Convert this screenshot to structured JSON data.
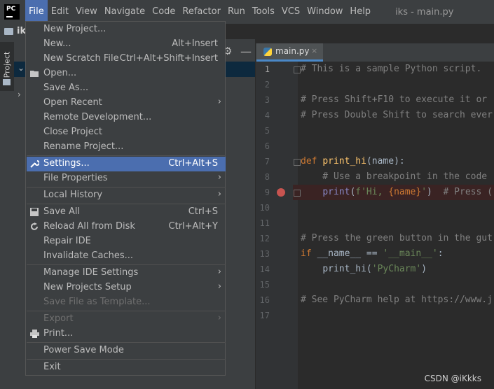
{
  "menubar": {
    "logo": "PC",
    "items": [
      "File",
      "Edit",
      "View",
      "Navigate",
      "Code",
      "Refactor",
      "Run",
      "Tools",
      "VCS",
      "Window",
      "Help"
    ],
    "window_title": "iks - main.py"
  },
  "project": {
    "strip_label": "ik",
    "tab_label": "Project"
  },
  "editor": {
    "tab_name": "main.py",
    "tab_close": "×",
    "lines": [
      {
        "num": "1"
      },
      {
        "num": "2"
      },
      {
        "num": "3"
      },
      {
        "num": "4"
      },
      {
        "num": "5"
      },
      {
        "num": "6"
      },
      {
        "num": "7"
      },
      {
        "num": "8"
      },
      {
        "num": "9"
      },
      {
        "num": "10"
      },
      {
        "num": "11"
      },
      {
        "num": "12"
      },
      {
        "num": "13"
      },
      {
        "num": "14"
      },
      {
        "num": "15"
      },
      {
        "num": "16"
      },
      {
        "num": "17"
      }
    ],
    "code": {
      "l1": "# This is a sample Python script.",
      "l3": "# Press Shift+F10 to execute it or",
      "l4": "# Press Double Shift to search ever",
      "l7_kw": "def ",
      "l7_fn": "print_hi",
      "l7_rest": "(name):",
      "l8": "    # Use a breakpoint in the code",
      "l9_indent": "    ",
      "l9_bi": "print",
      "l9_p1": "(",
      "l9_st1": "f'Hi, ",
      "l9_var": "{name}",
      "l9_st2": "'",
      "l9_p2": ")  ",
      "l9_cm": "# Press (",
      "l12": "# Press the green button in the gut",
      "l13_kw": "if ",
      "l13_mid": "__name__ == ",
      "l13_st": "'__main__'",
      "l13_end": ":",
      "l14_indent": "    ",
      "l14_fn": "print_hi(",
      "l14_st": "'PyCharm'",
      "l14_end": ")",
      "l16": "# See PyCharm help at https://www.j"
    }
  },
  "file_menu": {
    "new_project": "New Project...",
    "new": "New...",
    "new_short": "Alt+Insert",
    "new_scratch": "New Scratch File",
    "new_scratch_short": "Ctrl+Alt+Shift+Insert",
    "open": "Open...",
    "save_as": "Save As...",
    "open_recent": "Open Recent",
    "remote_dev": "Remote Development...",
    "close_project": "Close Project",
    "rename_project": "Rename Project...",
    "settings": "Settings...",
    "settings_short": "Ctrl+Alt+S",
    "file_properties": "File Properties",
    "local_history": "Local History",
    "save_all": "Save All",
    "save_all_short": "Ctrl+S",
    "reload": "Reload All from Disk",
    "reload_short": "Ctrl+Alt+Y",
    "repair_ide": "Repair IDE",
    "invalidate": "Invalidate Caches...",
    "manage_ide": "Manage IDE Settings",
    "new_projects_setup": "New Projects Setup",
    "save_template": "Save File as Template...",
    "export": "Export",
    "print": "Print...",
    "power_save": "Power Save Mode",
    "exit": "Exit",
    "submenu_arrow": "›"
  },
  "watermark": "CSDN @iKkks",
  "colors": {
    "menubar_bg": "#3c3f41",
    "selection": "#4b6eaf",
    "editor_bg": "#2b2b2b",
    "breakpoint": "#c75450"
  },
  "icons": [
    "settings-wrench-icon",
    "open-folder-icon",
    "save-all-icon",
    "reload-icon",
    "print-icon",
    "python-file-icon",
    "breakpoint-icon",
    "gear-icon",
    "minus-icon"
  ]
}
